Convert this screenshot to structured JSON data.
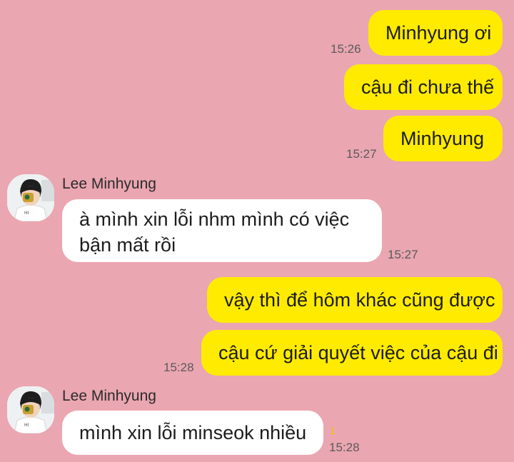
{
  "messages": {
    "m1": {
      "text": "Minhyung ơi",
      "time": "15:26"
    },
    "m2": {
      "text": "cậu đi chưa thế"
    },
    "m3": {
      "text": "Minhyung",
      "time": "15:27"
    },
    "m4": {
      "sender": "Lee Minhyung",
      "line1": "à mình xin lỗi nhm mình có việc",
      "line2": "bận mất rồi",
      "time": "15:27"
    },
    "m5": {
      "text": "vậy thì để hôm khác cũng được"
    },
    "m6": {
      "text": "cậu cứ giải quyết việc của cậu đi",
      "time": "15:28"
    },
    "m7": {
      "sender": "Lee Minhyung",
      "text": "mình xin lỗi minseok nhiều",
      "time": "15:28",
      "unread": "1"
    }
  },
  "colors": {
    "background": "#eaa6b1",
    "my_bubble": "#ffeb00",
    "their_bubble": "#ffffff"
  },
  "icons": [
    "avatar-icon"
  ]
}
